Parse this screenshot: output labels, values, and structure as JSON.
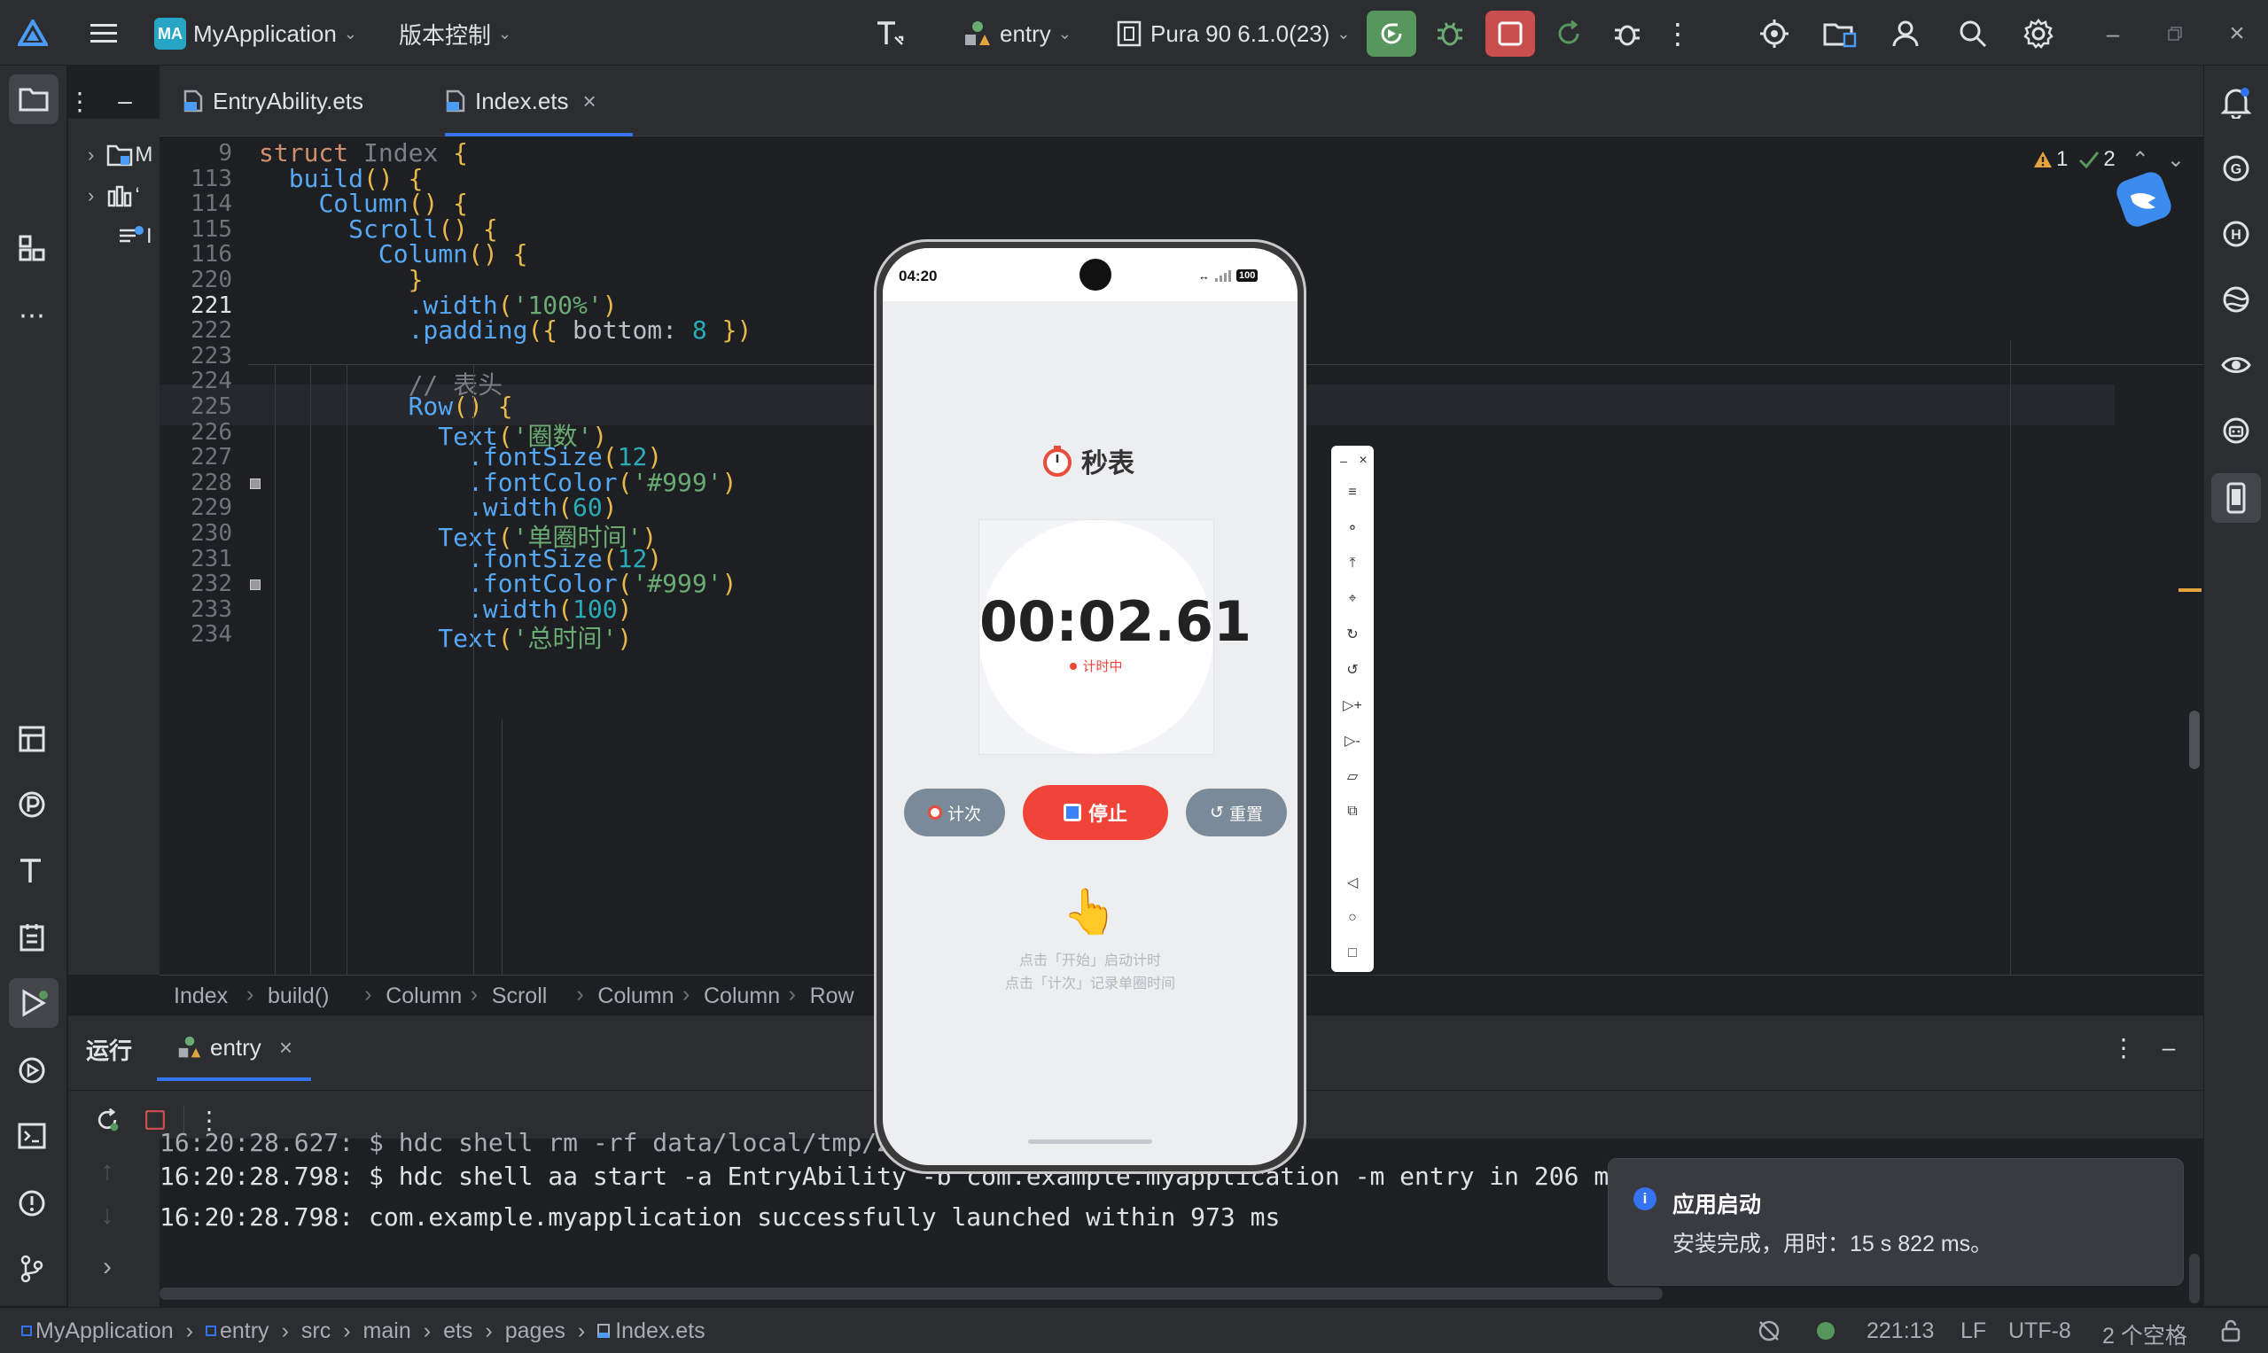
{
  "titlebar": {
    "project_badge": "MA",
    "project_name": "MyApplication",
    "vcs_label": "版本控制",
    "run_config": "entry",
    "device": "Pura 90 6.1.0(23)"
  },
  "tabs": [
    {
      "label": "EntryAbility.ets",
      "active": false
    },
    {
      "label": "Index.ets",
      "active": true
    }
  ],
  "project_tree": {
    "items": [
      "M",
      "‘",
      "I"
    ]
  },
  "inspection": {
    "warnings": "1",
    "ok": "2"
  },
  "editor": {
    "lines": [
      {
        "n": "9",
        "code": "struct Index {"
      },
      {
        "n": "113",
        "code": "  build() {"
      },
      {
        "n": "114",
        "code": "    Column() {"
      },
      {
        "n": "115",
        "code": "      Scroll() {"
      },
      {
        "n": "116",
        "code": "        Column() {"
      },
      {
        "n": "220",
        "code": "          }"
      },
      {
        "n": "221",
        "code": "          .width('100%')"
      },
      {
        "n": "222",
        "code": "          .padding({ bottom: 8 })"
      },
      {
        "n": "223",
        "code": ""
      },
      {
        "n": "224",
        "code": "          // 表头"
      },
      {
        "n": "225",
        "code": "          Row() {"
      },
      {
        "n": "226",
        "code": "            Text('圈数')"
      },
      {
        "n": "227",
        "code": "              .fontSize(12)"
      },
      {
        "n": "228",
        "code": "              .fontColor('#999')"
      },
      {
        "n": "229",
        "code": "              .width(60)"
      },
      {
        "n": "230",
        "code": "            Text('单圈时间')"
      },
      {
        "n": "231",
        "code": "              .fontSize(12)"
      },
      {
        "n": "232",
        "code": "              .fontColor('#999')"
      },
      {
        "n": "233",
        "code": "              .width(100)"
      },
      {
        "n": "234",
        "code": "            Text('总时间')"
      }
    ]
  },
  "breadcrumb": [
    "Index",
    "build()",
    "Column",
    "Scroll",
    "Column",
    "Column",
    "Row"
  ],
  "runpanel": {
    "title": "运行",
    "tab": "entry"
  },
  "console": {
    "lines": [
      "16:20:28.627: $ hdc shell rm -rf data/local/tmp/2f",
      "16:20:28.798: $ hdc shell aa start -a EntryAbility -b com.example.myapplication -m entry in 206 ms",
      "16:20:28.798: com.example.myapplication successfully launched within 973 ms"
    ]
  },
  "toast": {
    "title": "应用启动",
    "body": "安装完成，用时：15 s 822 ms。"
  },
  "statusbar": {
    "path": [
      "MyApplication",
      "entry",
      "src",
      "main",
      "ets",
      "pages",
      "Index.ets"
    ],
    "position": "221:13",
    "line_sep": "LF",
    "encoding": "UTF-8",
    "indent": "2 个空格"
  },
  "phone": {
    "time": "04:20",
    "battery": "100",
    "app_title": "秒表",
    "timer": "00:02.61",
    "state": "计时中",
    "buttons": {
      "lap": "计次",
      "stop": "停止",
      "reset": "重置"
    },
    "hint1": "点击「开始」启动计时",
    "hint2": "点击「计次」记录单圈时间"
  },
  "colors": {
    "accent_red": "#f04438",
    "gray_button": "#7b8a99",
    "ide_bg": "#1e1f22",
    "panel_bg": "#2b2d30",
    "run_green": "#57965c",
    "stop_red": "#c94f4f"
  }
}
